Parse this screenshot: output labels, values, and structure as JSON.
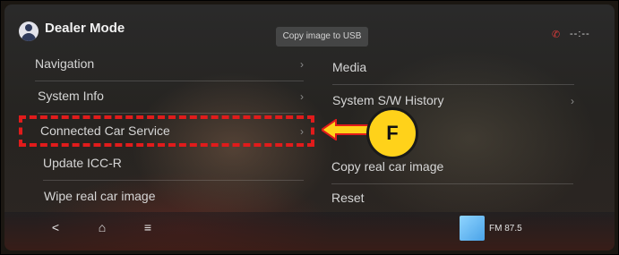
{
  "header": {
    "title": "Dealer Mode",
    "copy_image_usb": "Copy image to USB",
    "clock": "--:--"
  },
  "menu": {
    "left": [
      {
        "label": "Navigation"
      },
      {
        "label": "System Info"
      },
      {
        "label": "Connected Car Service"
      },
      {
        "label": "Update ICC-R"
      },
      {
        "label": "Wipe real car image"
      }
    ],
    "right": [
      {
        "label": "Media"
      },
      {
        "label": "System S/W History"
      },
      {
        "label": "Copy real car image"
      },
      {
        "label": "Reset"
      }
    ],
    "chevron": "›"
  },
  "annotation": {
    "badge": "F",
    "color": "#e11b1b",
    "badge_color": "#ffd21a"
  },
  "bottom_bar": {
    "back": "<",
    "home": "⌂",
    "menu": "≡",
    "radio": "FM 87.5"
  },
  "icons": {
    "avatar": "user-avatar-icon",
    "status": "mute-icon",
    "back": "back-icon",
    "home": "home-icon",
    "menu": "menu-icon"
  }
}
